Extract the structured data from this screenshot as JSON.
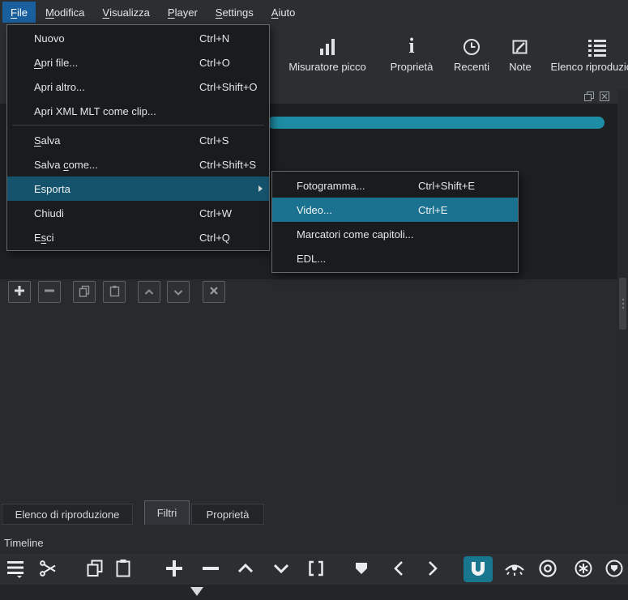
{
  "colors": {
    "accent_teal": "#1e8ca4",
    "menu_highlight": "#15526b",
    "submenu_highlight": "#1a7290",
    "menubar_highlight": "#1a5f9e",
    "magnet_active_bg": "#18778e"
  },
  "menubar": {
    "items": [
      {
        "label": "File",
        "u": 0,
        "active": true
      },
      {
        "label": "Modifica",
        "u": 0
      },
      {
        "label": "Visualizza",
        "u": 0
      },
      {
        "label": "Player",
        "u": 0
      },
      {
        "label": "Settings",
        "u": 0
      },
      {
        "label": "Aiuto",
        "u": 0
      }
    ]
  },
  "toolbar": {
    "items": [
      {
        "label": "Misuratore picco",
        "icon": "peak-meter-icon"
      },
      {
        "label": "Proprietà",
        "icon": "info-icon"
      },
      {
        "label": "Recenti",
        "icon": "clock-icon"
      },
      {
        "label": "Note",
        "icon": "note-icon"
      },
      {
        "label": "Elenco riproduzione",
        "icon": "playlist-icon"
      }
    ]
  },
  "file_menu": {
    "items": [
      {
        "label": "Nuovo",
        "shortcut": "Ctrl+N"
      },
      {
        "label": "Apri file...",
        "u": 0,
        "shortcut": "Ctrl+O"
      },
      {
        "label": "Apri altro...",
        "shortcut": "Ctrl+Shift+O"
      },
      {
        "label": "Apri XML MLT come clip...",
        "shortcut": ""
      },
      {
        "label": "Salva",
        "u": 0,
        "shortcut": "Ctrl+S"
      },
      {
        "label": "Salva come...",
        "u": 6,
        "shortcut": "Ctrl+Shift+S"
      },
      {
        "label": "Esporta",
        "shortcut": "",
        "highlighted": true,
        "has_submenu": true
      },
      {
        "label": "Chiudi",
        "shortcut": "Ctrl+W"
      },
      {
        "label": "Esci",
        "u": 1,
        "shortcut": "Ctrl+Q"
      }
    ]
  },
  "export_submenu": {
    "items": [
      {
        "label": "Fotogramma...",
        "shortcut": "Ctrl+Shift+E"
      },
      {
        "label": "Video...",
        "shortcut": "Ctrl+E",
        "highlighted": true
      },
      {
        "label": "Marcatori come capitoli...",
        "shortcut": ""
      },
      {
        "label": "EDL...",
        "shortcut": ""
      }
    ]
  },
  "tabs": {
    "items": [
      {
        "label": "Elenco di riproduzione"
      },
      {
        "label": "Filtri",
        "active": true
      },
      {
        "label": "Proprietà"
      }
    ]
  },
  "timeline": {
    "label": "Timeline"
  }
}
